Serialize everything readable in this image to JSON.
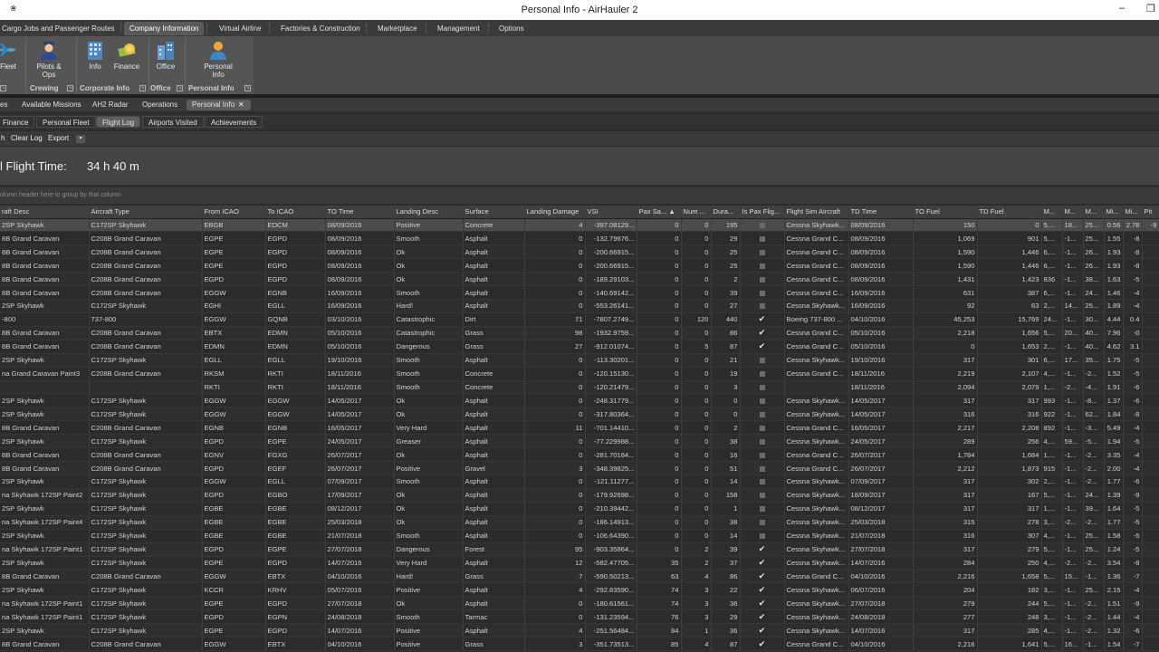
{
  "window": {
    "title": "Personal Info - AirHauler 2",
    "system_icon": "❀",
    "minimize": "–",
    "maximize": "❐"
  },
  "ribbon_tabs": [
    {
      "label": "Cargo Jobs and Passenger Routes"
    },
    {
      "label": "Company Information"
    },
    {
      "label": "Virtual Airline"
    },
    {
      "label": "Factories & Construction"
    },
    {
      "label": "Marketplace"
    },
    {
      "label": "Management"
    },
    {
      "label": "Options"
    }
  ],
  "ribbon": {
    "fleet_label": "Fleet",
    "pilots_label": "Pilots & Ops",
    "info_label": "Info",
    "finance_label": "Finance",
    "office_label": "Office",
    "personal_label": "Personal Info",
    "groups": {
      "crewing": "Crewing",
      "corporate": "Corporate Info",
      "office": "Office",
      "personal": "Personal Info"
    }
  },
  "doc_tabs": [
    {
      "label": "es"
    },
    {
      "label": "Available Missions"
    },
    {
      "label": "AH2 Radar"
    },
    {
      "label": "Operations"
    },
    {
      "label": "Personal Info"
    }
  ],
  "doc_tab_close": "✕",
  "sub_tabs": [
    {
      "label": "Finance"
    },
    {
      "label": "Personal Fleet"
    },
    {
      "label": "Flight Log"
    },
    {
      "label": "Airports Visited"
    },
    {
      "label": "Achievements"
    }
  ],
  "toolbar": {
    "cut_label": "h",
    "clear_log": "Clear Log",
    "export": "Export",
    "caret": "▾"
  },
  "flight_time": {
    "label": "l Flight Time:",
    "value": "34 h 40 m"
  },
  "group_hint": "olumn header here to group by that column",
  "grid": {
    "columns": [
      "raft Desc",
      "Aircraft Type",
      "From ICAO",
      "To ICAO",
      "TO Time",
      "Landing Desc",
      "Surface",
      "Landing Damage",
      "VSI",
      "Pax Sa... ▲",
      "Num ...",
      "Dura...",
      "Is Pax Flig...",
      "Flight Sim Aircraft",
      "TD Time",
      "TO Fuel",
      "TD Fuel",
      "M...",
      "M...",
      "M...",
      "Mi...",
      "Mi...",
      "Pit"
    ],
    "rows": [
      [
        "2SP Skyhawk",
        "C172SP Skyhawk",
        "EBGB",
        "EDCM",
        "08/09/2016",
        "Positive",
        "Concrete",
        "4",
        "-397.08129...",
        "0",
        "0",
        "195",
        "n",
        "Cessna Skyhawk...",
        "08/09/2016",
        "150",
        "0",
        "5,...",
        "18...",
        "25...",
        "-0...",
        "0.56",
        "2.78",
        "-9"
      ],
      [
        "8B Grand Caravan",
        "C208B Grand Caravan",
        "EGPE",
        "EGPD",
        "08/09/2016",
        "Smooth",
        "Asphalt",
        "0",
        "-132.79676...",
        "0",
        "0",
        "29",
        "n",
        "Cessna Grand C...",
        "08/09/2016",
        "1,069",
        "901",
        "5,...",
        "-1...",
        "25...",
        "0.63",
        "1.55",
        "-8"
      ],
      [
        "8B Grand Caravan",
        "C208B Grand Caravan",
        "EGPE",
        "EGPD",
        "08/09/2016",
        "Ok",
        "Asphalt",
        "0",
        "-200.66915...",
        "0",
        "0",
        "25",
        "n",
        "Cessna Grand C...",
        "08/09/2016",
        "1,590",
        "1,446",
        "6,...",
        "-1...",
        "26...",
        "0.74",
        "1.93",
        "-8"
      ],
      [
        "8B Grand Caravan",
        "C208B Grand Caravan",
        "EGPE",
        "EGPD",
        "08/09/2016",
        "Ok",
        "Asphalt",
        "0",
        "-200.66915...",
        "0",
        "0",
        "25",
        "n",
        "Cessna Grand C...",
        "08/09/2016",
        "1,590",
        "1,446",
        "6,...",
        "-1...",
        "26...",
        "0.74",
        "1.93",
        "-8"
      ],
      [
        "8B Grand Caravan",
        "C208B Grand Caravan",
        "EGPD",
        "EGPD",
        "08/09/2016",
        "Ok",
        "Asphalt",
        "0",
        "-189.29103...",
        "0",
        "0",
        "2",
        "n",
        "Cessna Grand C...",
        "08/09/2016",
        "1,431",
        "1,423",
        "836",
        "-1...",
        "38...",
        "0.78",
        "1.63",
        "-5"
      ],
      [
        "8B Grand Caravan",
        "C208B Grand Caravan",
        "EGGW",
        "EGNB",
        "16/09/2016",
        "Smooth",
        "Asphalt",
        "0",
        "-140.69142...",
        "0",
        "0",
        "39",
        "n",
        "Cessna Grand C...",
        "16/09/2016",
        "631",
        "387",
        "6,...",
        "-1...",
        "24...",
        "0.47",
        "1.46",
        "-4"
      ],
      [
        "2SP Skyhawk",
        "C172SP Skyhawk",
        "EGHI",
        "EGLL",
        "16/09/2016",
        "Hard!",
        "Asphalt",
        "0",
        "-553.26141...",
        "0",
        "0",
        "27",
        "n",
        "Cessna Skyhawk...",
        "16/09/2016",
        "92",
        "63",
        "2,...",
        "14...",
        "25...",
        "0.37",
        "1.89",
        "-4"
      ],
      [
        "-800",
        "737-800",
        "EGGW",
        "GQNB",
        "03/10/2016",
        "Catastrophic",
        "Dirt",
        "71",
        "-7807.2749...",
        "0",
        "120",
        "440",
        "y",
        "Boeing 737-800 ...",
        "04/10/2016",
        "45,253",
        "15,769",
        "24...",
        "-1...",
        "30...",
        "0.56",
        "4.44",
        "0.4"
      ],
      [
        "8B Grand Caravan",
        "C208B Grand Caravan",
        "EBTX",
        "EDMN",
        "05/10/2016",
        "Catastrophic",
        "Grass",
        "98",
        "-1932.9759...",
        "0",
        "0",
        "86",
        "y",
        "Cessna Grand C...",
        "05/10/2016",
        "2,218",
        "1,656",
        "5,...",
        "20...",
        "40...",
        "0.42",
        "7.96",
        "-0"
      ],
      [
        "8B Grand Caravan",
        "C208B Grand Caravan",
        "EDMN",
        "EDMN",
        "05/10/2016",
        "Dangerous",
        "Grass",
        "27",
        "-912.01074...",
        "0",
        "5",
        "87",
        "y",
        "Cessna Grand C...",
        "05/10/2016",
        "0",
        "1,653",
        "2,...",
        "-1...",
        "40...",
        "0.00",
        "4.62",
        "3.1"
      ],
      [
        "2SP Skyhawk",
        "C172SP Skyhawk",
        "EGLL",
        "EGLL",
        "19/10/2016",
        "Smooth",
        "Asphalt",
        "0",
        "-113.30201...",
        "0",
        "0",
        "21",
        "n",
        "Cessna Skyhawk...",
        "19/10/2016",
        "317",
        "301",
        "6,...",
        "17...",
        "35...",
        "0.79",
        "1.75",
        "-5"
      ],
      [
        "na Grand Caravan Paint3",
        "C208B Grand Caravan",
        "RKSM",
        "RKTI",
        "18/11/2016",
        "Smooth",
        "Concrete",
        "0",
        "-120.15130...",
        "0",
        "0",
        "19",
        "n",
        "Cessna Grand C...",
        "18/11/2016",
        "2,219",
        "2,107",
        "4,...",
        "-1...",
        "-2...",
        "0.25",
        "1.52",
        "-5"
      ],
      [
        "",
        "",
        "RKTI",
        "RKTI",
        "18/11/2016",
        "Smooth",
        "Concrete",
        "0",
        "-120.21479...",
        "0",
        "0",
        "3",
        "n",
        "",
        "18/11/2016",
        "2,094",
        "2,079",
        "1,...",
        "-2...",
        "-4...",
        "0.25",
        "1.91",
        "-6"
      ],
      [
        "2SP Skyhawk",
        "C172SP Skyhawk",
        "EGGW",
        "EGGW",
        "14/05/2017",
        "Ok",
        "Asphalt",
        "0",
        "-248.31779...",
        "0",
        "0",
        "0",
        "n",
        "Cessna Skyhawk...",
        "14/05/2017",
        "317",
        "317",
        "993",
        "-1...",
        "-8...",
        "0.81",
        "1.37",
        "-6"
      ],
      [
        "2SP Skyhawk",
        "C172SP Skyhawk",
        "EGGW",
        "EGGW",
        "14/05/2017",
        "Ok",
        "Asphalt",
        "0",
        "-317.80364...",
        "0",
        "0",
        "0",
        "n",
        "Cessna Skyhawk...",
        "14/05/2017",
        "316",
        "316",
        "922",
        "-1...",
        "62...",
        "0.73",
        "1.84",
        "-8"
      ],
      [
        "8B Grand Caravan",
        "C208B Grand Caravan",
        "EGNB",
        "EGNB",
        "16/05/2017",
        "Very Hard",
        "Asphalt",
        "11",
        "-701.14410...",
        "0",
        "0",
        "2",
        "n",
        "Cessna Grand C...",
        "16/05/2017",
        "2,217",
        "2,208",
        "892",
        "-1...",
        "-3...",
        "0.61",
        "5.49",
        "-4"
      ],
      [
        "2SP Skyhawk",
        "C172SP Skyhawk",
        "EGPD",
        "EGPE",
        "24/05/2017",
        "Greaser",
        "Asphalt",
        "0",
        "-77.229988...",
        "0",
        "0",
        "38",
        "n",
        "Cessna Skyhawk...",
        "24/05/2017",
        "289",
        "256",
        "4,...",
        "59...",
        "-5...",
        "0.00",
        "1.94",
        "-5"
      ],
      [
        "8B Grand Caravan",
        "C208B Grand Caravan",
        "EGNV",
        "EGXG",
        "26/07/2017",
        "Ok",
        "Asphalt",
        "0",
        "-281.70184...",
        "0",
        "0",
        "16",
        "n",
        "Cessna Grand C...",
        "26/07/2017",
        "1,784",
        "1,684",
        "1,...",
        "-1...",
        "-2...",
        "0.70",
        "3.35",
        "-4"
      ],
      [
        "8B Grand Caravan",
        "C208B Grand Caravan",
        "EGPD",
        "EGEF",
        "26/07/2017",
        "Positive",
        "Gravel",
        "3",
        "-348.39825...",
        "0",
        "0",
        "51",
        "n",
        "Cessna Grand C...",
        "26/07/2017",
        "2,212",
        "1,873",
        "915",
        "-1...",
        "-2...",
        "0.72",
        "2.00",
        "-4"
      ],
      [
        "2SP Skyhawk",
        "C172SP Skyhawk",
        "EGGW",
        "EGLL",
        "07/09/2017",
        "Smooth",
        "Asphalt",
        "0",
        "-121.11277...",
        "0",
        "0",
        "14",
        "n",
        "Cessna Skyhawk...",
        "07/09/2017",
        "317",
        "302",
        "2,...",
        "-1...",
        "-2...",
        "0.63",
        "1.77",
        "-6"
      ],
      [
        "na Skyhawk 172SP Paint2",
        "C172SP Skyhawk",
        "EGPD",
        "EGBO",
        "17/09/2017",
        "Ok",
        "Asphalt",
        "0",
        "-179.92698...",
        "0",
        "0",
        "158",
        "n",
        "Cessna Skyhawk...",
        "18/09/2017",
        "317",
        "167",
        "5,...",
        "-1...",
        "24...",
        "0.77",
        "1.39",
        "-9"
      ],
      [
        "2SP Skyhawk",
        "C172SP Skyhawk",
        "EGBE",
        "EGBE",
        "08/12/2017",
        "Ok",
        "Asphalt",
        "0",
        "-210.39442...",
        "0",
        "0",
        "1",
        "n",
        "Cessna Skyhawk...",
        "08/12/2017",
        "317",
        "317",
        "1,...",
        "-1...",
        "39...",
        "0.71",
        "1.64",
        "-5"
      ],
      [
        "na Skyhawk 172SP Paint4",
        "C172SP Skyhawk",
        "EGBE",
        "EGBE",
        "25/03/2018",
        "Ok",
        "Asphalt",
        "0",
        "-186.14913...",
        "0",
        "0",
        "38",
        "n",
        "Cessna Skyhawk...",
        "25/03/2018",
        "315",
        "278",
        "3,...",
        "-2...",
        "-2...",
        "0.46",
        "1.77",
        "-5"
      ],
      [
        "2SP Skyhawk",
        "C172SP Skyhawk",
        "EGBE",
        "EGBE",
        "21/07/2018",
        "Smooth",
        "Asphalt",
        "0",
        "-106.64390...",
        "0",
        "0",
        "14",
        "n",
        "Cessna Skyhawk...",
        "21/07/2018",
        "316",
        "307",
        "4,...",
        "-1...",
        "25...",
        "0.79",
        "1.58",
        "-5"
      ],
      [
        "na Skyhawk 172SP Paint1",
        "C172SP Skyhawk",
        "EGPD",
        "EGPE",
        "27/07/2018",
        "Dangerous",
        "Forest",
        "95",
        "-903.35864...",
        "0",
        "2",
        "39",
        "y",
        "Cessna Skyhawk...",
        "27/07/2018",
        "317",
        "279",
        "5,...",
        "-1...",
        "25...",
        "0.69",
        "1.24",
        "-5"
      ],
      [
        "2SP Skyhawk",
        "C172SP Skyhawk",
        "EGPE",
        "EGPD",
        "14/07/2016",
        "Very Hard",
        "Asphalt",
        "12",
        "-582.47705...",
        "35",
        "2",
        "37",
        "y",
        "Cessna Skyhawk...",
        "14/07/2016",
        "284",
        "250",
        "4,...",
        "-2...",
        "-2...",
        "0.73",
        "3.54",
        "-8"
      ],
      [
        "8B Grand Caravan",
        "C208B Grand Caravan",
        "EGGW",
        "EBTX",
        "04/10/2016",
        "Hard!",
        "Grass",
        "7",
        "-590.50213...",
        "63",
        "4",
        "86",
        "y",
        "Cessna Grand C...",
        "04/10/2016",
        "2,216",
        "1,658",
        "5,...",
        "15...",
        "-1...",
        "0.84",
        "1.36",
        "-7"
      ],
      [
        "2SP Skyhawk",
        "C172SP Skyhawk",
        "KCCR",
        "KRHV",
        "05/07/2016",
        "Positive",
        "Asphalt",
        "4",
        "-292.83590...",
        "74",
        "3",
        "22",
        "y",
        "Cessna Skyhawk...",
        "06/07/2016",
        "204",
        "182",
        "3,...",
        "-1...",
        "25...",
        "0.76",
        "2.15",
        "-4"
      ],
      [
        "na Skyhawk 172SP Paint1",
        "C172SP Skyhawk",
        "EGPE",
        "EGPD",
        "27/07/2018",
        "Ok",
        "Asphalt",
        "0",
        "-180.61561...",
        "74",
        "3",
        "36",
        "y",
        "Cessna Skyhawk...",
        "27/07/2018",
        "279",
        "244",
        "5,...",
        "-1...",
        "-2...",
        "0.69",
        "1.51",
        "-9"
      ],
      [
        "na Skyhawk 172SP Paint1",
        "C172SP Skyhawk",
        "EGPD",
        "EGPN",
        "24/08/2018",
        "Smooth",
        "Tarmac",
        "0",
        "-131.23594...",
        "76",
        "3",
        "29",
        "y",
        "Cessna Skyhawk...",
        "24/08/2018",
        "277",
        "248",
        "3,...",
        "-1...",
        "-2...",
        "0.72",
        "1.44",
        "-4"
      ],
      [
        "2SP Skyhawk",
        "C172SP Skyhawk",
        "EGPE",
        "EGPD",
        "14/07/2016",
        "Positive",
        "Asphalt",
        "4",
        "-251.56484...",
        "84",
        "1",
        "36",
        "y",
        "Cessna Skyhawk...",
        "14/07/2016",
        "317",
        "285",
        "4,...",
        "-1...",
        "-2...",
        "0.72",
        "1.32",
        "-6"
      ],
      [
        "8B Grand Caravan",
        "C208B Grand Caravan",
        "EGGW",
        "EBTX",
        "04/10/2016",
        "Positive",
        "Grass",
        "3",
        "-351.73513...",
        "85",
        "4",
        "87",
        "y",
        "Cessna Grand C...",
        "04/10/2016",
        "2,216",
        "1,641",
        "5,...",
        "16...",
        "-1...",
        "0.67",
        "1.54",
        "-7"
      ]
    ]
  }
}
